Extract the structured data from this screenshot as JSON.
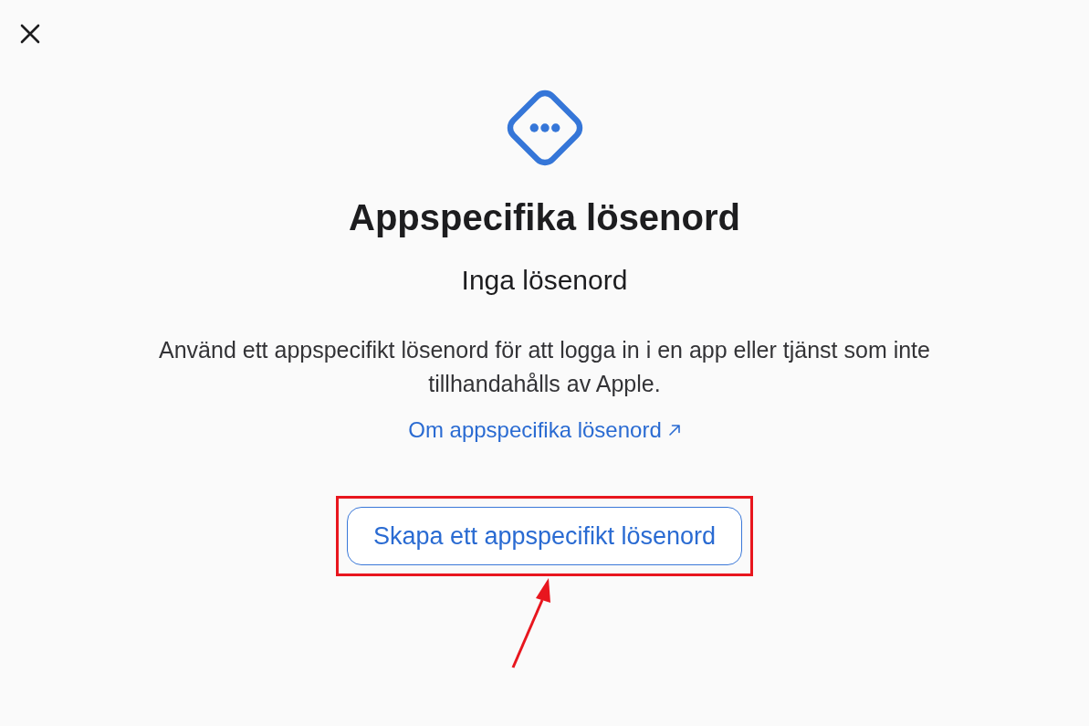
{
  "title": "Appspecifika lösenord",
  "status": "Inga lösenord",
  "description": "Använd ett appspecifikt lösenord för att logga in i en app eller tjänst som inte tillhandahålls av Apple.",
  "link": {
    "label": "Om appspecifika lösenord",
    "external": true
  },
  "button": {
    "label": "Skapa ett appspecifikt lösenord",
    "highlighted": true
  }
}
